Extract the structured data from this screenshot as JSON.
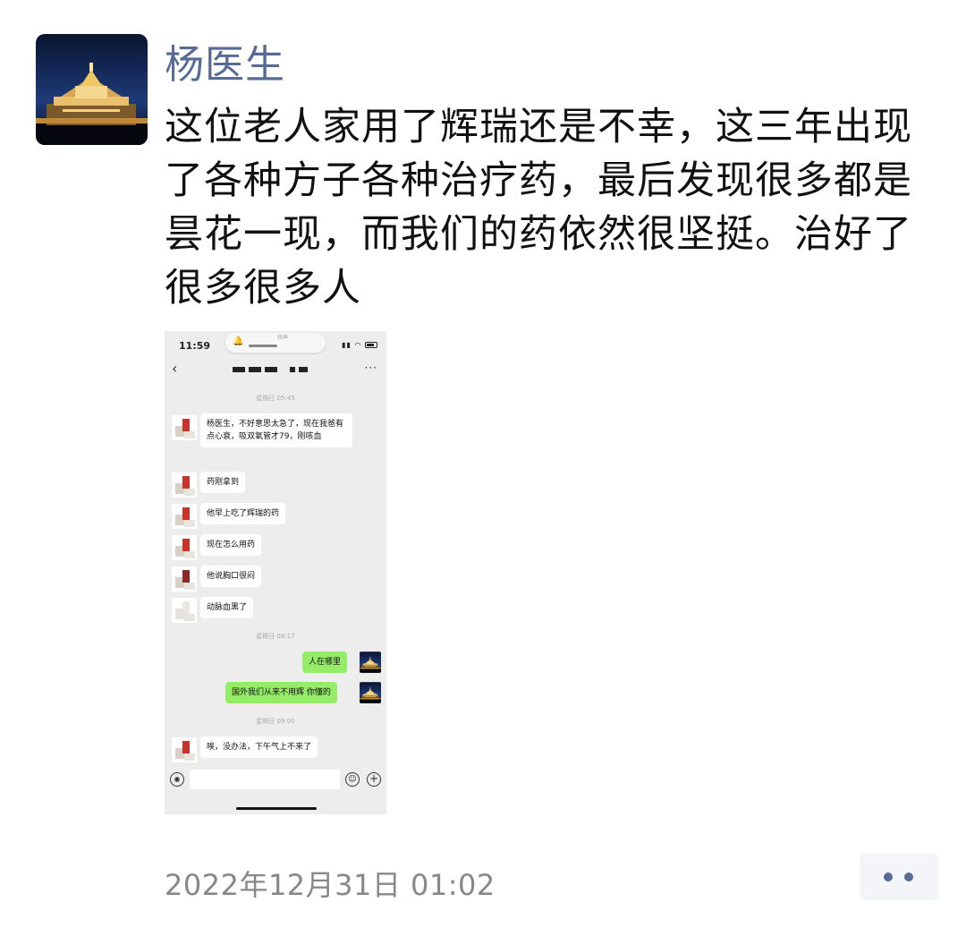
{
  "post": {
    "author": "杨医生",
    "text": "这位老人家用了辉瑞还是不幸，这三年出现了各种方子各种治疗药，最后发现很多都是昙花一现，而我们的药依然很坚挺。治好了很多很多人",
    "timestamp": "2022年12月31日 01:02"
  },
  "screenshot": {
    "status": {
      "time": "11:59",
      "island_label": "铃声"
    },
    "nav": {
      "back": "‹",
      "more": "···"
    },
    "timestamps": [
      "星期日 05:45",
      "星期日 08:17",
      "星期日 09:00"
    ],
    "incoming": [
      "杨医生，不好意思太急了，现在我爸有点心衰，吸双氧管才79，刚咳血",
      "药刚拿到",
      "他早上吃了辉瑞的药",
      "现在怎么用药",
      "他说胸口很闷",
      "动脉血黑了"
    ],
    "outgoing": [
      "人在哪里",
      "国外我们从来不用辉 你懂的"
    ],
    "last_incoming": "唉，没办法，下午气上不来了"
  },
  "icons": [
    "avatar-temple",
    "bell-icon",
    "signal-icon",
    "wifi-icon",
    "battery-icon",
    "back-icon",
    "more-icon",
    "voice-icon",
    "emoji-icon",
    "plus-icon",
    "more-dots-icon"
  ],
  "colors": {
    "author": "#576b95",
    "outgoing_bubble": "#95ec69",
    "chat_bg": "#ededed",
    "timestamp": "#888888"
  }
}
